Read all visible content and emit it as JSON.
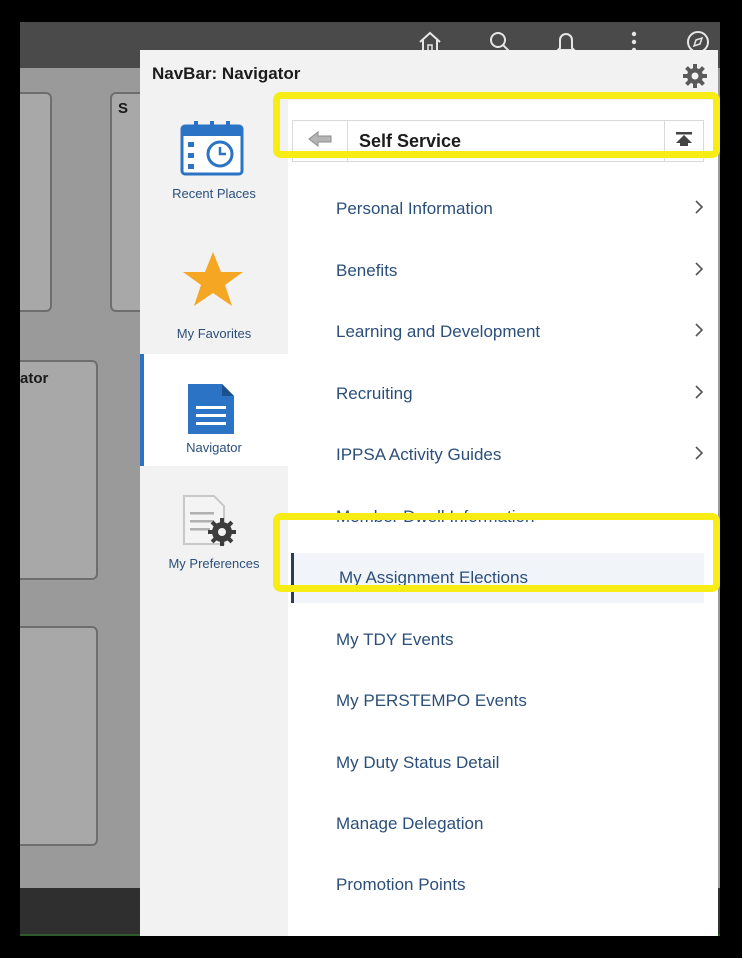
{
  "background": {
    "tile_text_1": "S",
    "tile_text_2": "ator"
  },
  "topbar": {
    "icons": [
      "home-icon",
      "search-icon",
      "bell-icon",
      "more-icon",
      "compass-icon"
    ]
  },
  "panel": {
    "title": "NavBar: Navigator",
    "settings_icon": "gear-icon"
  },
  "left_tabs": [
    {
      "label": "Recent Places",
      "icon": "calendar-clock-icon",
      "selected": false
    },
    {
      "label": "My Favorites",
      "icon": "star-icon",
      "selected": false
    },
    {
      "label": "Navigator",
      "icon": "document-icon",
      "selected": true
    },
    {
      "label": "My Preferences",
      "icon": "preferences-icon",
      "selected": false
    }
  ],
  "section": {
    "title": "Self Service",
    "back_icon": "back-arrow-icon",
    "collapse_icon": "collapse-to-top-icon"
  },
  "menu_items": [
    {
      "label": "Personal Information",
      "has_children": true
    },
    {
      "label": "Benefits",
      "has_children": true
    },
    {
      "label": "Learning and Development",
      "has_children": true
    },
    {
      "label": "Recruiting",
      "has_children": true
    },
    {
      "label": "IPPSA Activity Guides",
      "has_children": true
    },
    {
      "label": "Member Dwell Information",
      "has_children": false
    },
    {
      "label": "My Assignment Elections",
      "has_children": false,
      "selected": true
    },
    {
      "label": "My TDY Events",
      "has_children": false
    },
    {
      "label": "My PERSTEMPO Events",
      "has_children": false
    },
    {
      "label": "My Duty Status Detail",
      "has_children": false
    },
    {
      "label": "Manage Delegation",
      "has_children": false
    },
    {
      "label": "Promotion Points",
      "has_children": false
    }
  ],
  "colors": {
    "highlight": "#f7ed14",
    "link_text": "#2b4f7a",
    "selected_tab_border": "#2a73c5",
    "favorites_star": "#f5a623",
    "recent_places_icon": "#2a73c5"
  }
}
